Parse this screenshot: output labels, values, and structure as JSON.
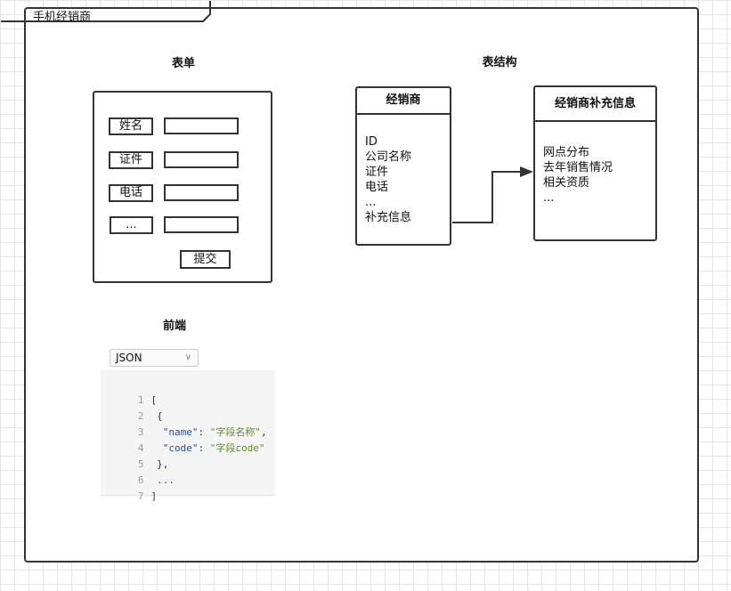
{
  "frame": {
    "title": "手机经销商"
  },
  "sections": {
    "form_title": "表单",
    "table_title": "表结构",
    "frontend_title": "前端"
  },
  "form": {
    "fields": [
      {
        "label": "姓名"
      },
      {
        "label": "证件"
      },
      {
        "label": "电话"
      },
      {
        "label": "..."
      }
    ],
    "submit_label": "提交"
  },
  "entities": {
    "dealer": {
      "title": "经销商",
      "fields": [
        "ID",
        "公司名称",
        "证件",
        "电话",
        "...",
        "补充信息"
      ]
    },
    "dealer_info": {
      "title": "经销商补充信息",
      "fields": [
        "网点分布",
        "去年销售情况",
        "相关资质",
        "..."
      ]
    }
  },
  "frontend": {
    "format_select": "JSON",
    "code": {
      "line_numbers": [
        "1",
        "2",
        "3",
        "4",
        "5",
        "6",
        "7"
      ],
      "open_bracket": "[",
      "open_brace": "{",
      "name_key": "\"name\"",
      "name_value": "\"字段名称\"",
      "code_key": "\"code\"",
      "code_value": "\"字段code\"",
      "close_brace": "},",
      "ellipsis": "...",
      "close_bracket": "]"
    }
  }
}
